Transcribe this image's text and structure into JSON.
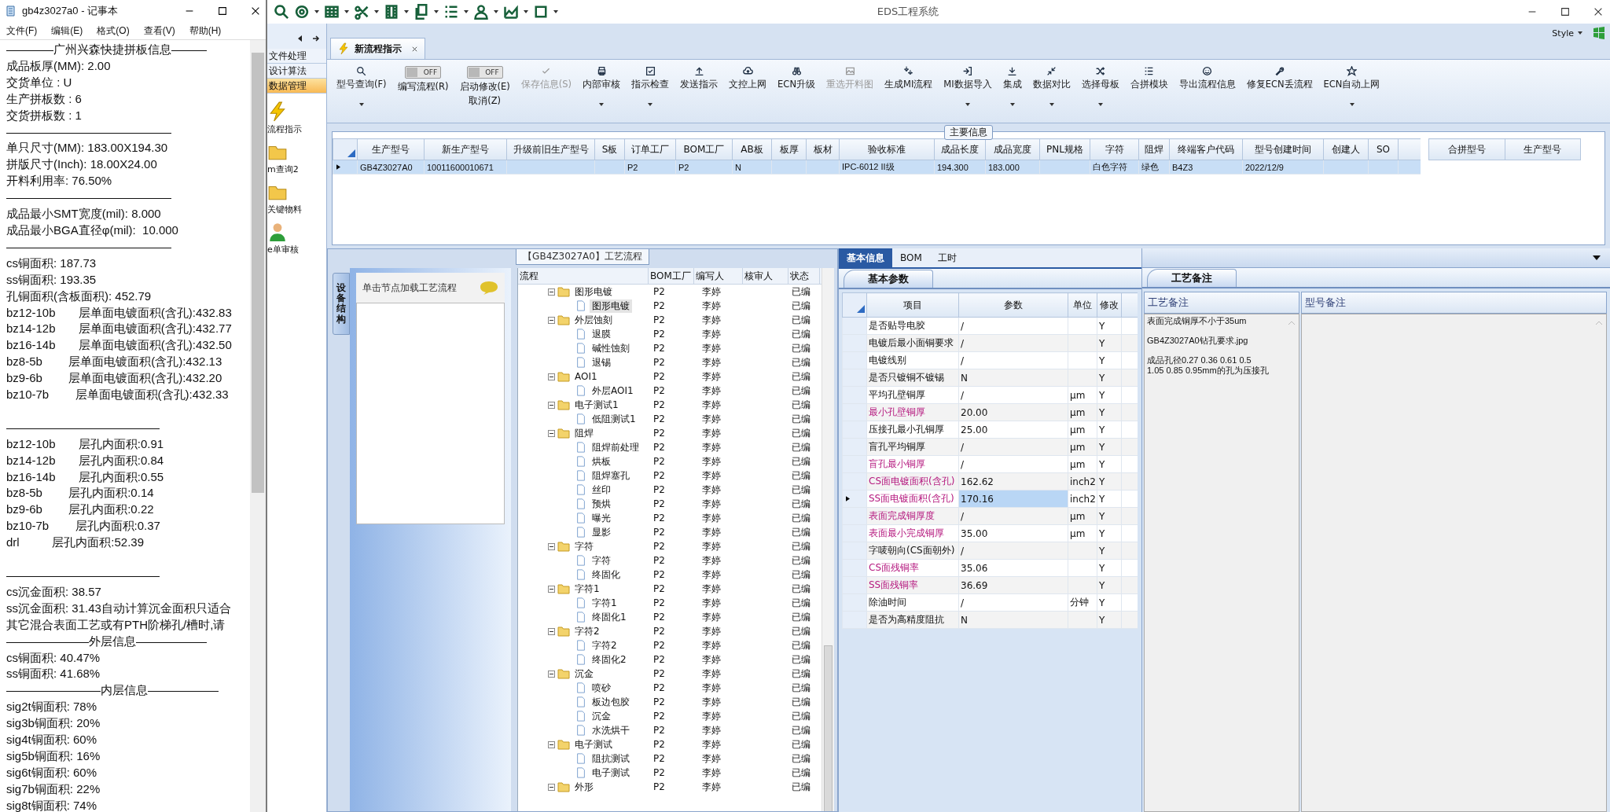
{
  "notepad": {
    "title": "gb4z3027a0 - 记事本",
    "menu": [
      "文件(F)",
      "编辑(E)",
      "格式(O)",
      "查看(V)",
      "帮助(H)"
    ],
    "lines": [
      {
        "text": "————广州兴森快捷拼板信息———",
        "space_before": false
      },
      {
        "text": "成品板厚(MM): 2.00",
        "space_before": false
      },
      {
        "text": "交货单位 : U",
        "space_before": false
      },
      {
        "text": "生产拼板数 : 6",
        "space_before": false
      },
      {
        "text": "交货拼板数 : 1",
        "space_before": false
      },
      {
        "text": "——————————————",
        "space_before": false
      },
      {
        "text": "单只尺寸(MM): 183.00X194.30",
        "space_before": false
      },
      {
        "text": "拼版尺寸(Inch): 18.00X24.00",
        "space_before": false
      },
      {
        "text": "开料利用率: 76.50%",
        "space_before": false
      },
      {
        "text": "——————————————",
        "space_before": false
      },
      {
        "text": "成品最小SMT宽度(mil): 8.000",
        "space_before": false
      },
      {
        "text": "成品最小BGA直径φ(mil):  10.000",
        "space_before": false
      },
      {
        "text": "——————————————",
        "space_before": false
      },
      {
        "text": "cs铜面积: 187.73",
        "space_before": false
      },
      {
        "text": "ss铜面积: 193.35",
        "space_before": false
      },
      {
        "text": "孔铜面积(含板面积): 452.79",
        "space_before": false
      },
      {
        "text": "bz12-10b       层单面电镀面积(含孔):432.83",
        "space_before": false
      },
      {
        "text": "bz14-12b       层单面电镀面积(含孔):432.77",
        "space_before": false
      },
      {
        "text": "bz16-14b       层单面电镀面积(含孔):432.50",
        "space_before": false
      },
      {
        "text": "bz8-5b        层单面电镀面积(含孔):432.13",
        "space_before": false
      },
      {
        "text": "bz9-6b        层单面电镀面积(含孔):432.20",
        "space_before": false
      },
      {
        "text": "bz10-7b        层单面电镀面积(含孔):432.33",
        "space_before": false
      },
      {
        "text": "—————————————",
        "space_before": true
      },
      {
        "text": "bz12-10b       层孔内面积:0.91",
        "space_before": false
      },
      {
        "text": "bz14-12b       层孔内面积:0.84",
        "space_before": false
      },
      {
        "text": "bz16-14b       层孔内面积:0.55",
        "space_before": false
      },
      {
        "text": "bz8-5b        层孔内面积:0.14",
        "space_before": false
      },
      {
        "text": "bz9-6b        层孔内面积:0.22",
        "space_before": false
      },
      {
        "text": "bz10-7b        层孔内面积:0.37",
        "space_before": false
      },
      {
        "text": "drl          层孔内面积:52.39",
        "space_before": false
      },
      {
        "text": "—————————————",
        "space_before": true
      },
      {
        "text": "cs沉金面积: 38.57",
        "space_before": false
      },
      {
        "text": "ss沉金面积: 31.43自动计算沉金面积只适合",
        "space_before": false
      },
      {
        "text": "其它混合表面工艺或有PTH阶梯孔/槽时,请",
        "space_before": false
      },
      {
        "text": "———————外层信息——————",
        "space_before": false
      },
      {
        "text": "cs铜面积: 40.47%",
        "space_before": false
      },
      {
        "text": "ss铜面积: 41.68%",
        "space_before": false
      },
      {
        "text": "————————内层信息——————",
        "space_before": false
      },
      {
        "text": "sig2t铜面积: 78%",
        "space_before": false
      },
      {
        "text": "sig3b铜面积: 20%",
        "space_before": false
      },
      {
        "text": "sig4t铜面积: 60%",
        "space_before": false
      },
      {
        "text": "sig5b铜面积: 16%",
        "space_before": false
      },
      {
        "text": "sig6t铜面积: 60%",
        "space_before": false
      },
      {
        "text": "sig7b铜面积: 22%",
        "space_before": false
      },
      {
        "text": "sig8t铜面积: 74%",
        "space_before": false
      }
    ]
  },
  "app": {
    "title": "EDS工程系统",
    "style_label": "Style"
  },
  "nav": {
    "menu": [
      {
        "label": "文件处理",
        "selected": false
      },
      {
        "label": "设计算法",
        "selected": false
      },
      {
        "label": "数据管理",
        "selected": true
      }
    ],
    "items": [
      {
        "label": "流程指示"
      },
      {
        "label": "m查询2"
      },
      {
        "label": "关键物料"
      },
      {
        "label": "e单审核"
      }
    ]
  },
  "tab": {
    "label": "新流程指示"
  },
  "ribbon": [
    {
      "kind": "button",
      "label": "型号查询(F)",
      "disabled": false,
      "dropdown": true
    },
    {
      "kind": "toggle",
      "label": "编写流程(R)",
      "on": false,
      "switch_text": "OFF"
    },
    {
      "kind": "toggle",
      "label": "启动修改(E)",
      "sublabel": "取消(Z)",
      "on": false,
      "switch_text": "OFF"
    },
    {
      "kind": "button",
      "label": "保存信息(S)",
      "disabled": true,
      "dropdown": false
    },
    {
      "kind": "button",
      "label": "内部审核",
      "disabled": false,
      "dropdown": true
    },
    {
      "kind": "button",
      "label": "指示检查",
      "disabled": false,
      "dropdown": true
    },
    {
      "kind": "button",
      "label": "发送指示",
      "disabled": false,
      "dropdown": false
    },
    {
      "kind": "button",
      "label": "文控上网",
      "disabled": false,
      "dropdown": false
    },
    {
      "kind": "button",
      "label": "ECN升级",
      "disabled": false,
      "dropdown": false
    },
    {
      "kind": "button",
      "label": "重选开料图",
      "disabled": true,
      "dropdown": false
    },
    {
      "kind": "button",
      "label": "生成MI流程",
      "disabled": false,
      "dropdown": false
    },
    {
      "kind": "button",
      "label": "MI数据导入",
      "disabled": false,
      "dropdown": true
    },
    {
      "kind": "button",
      "label": "集成",
      "disabled": false,
      "dropdown": true
    },
    {
      "kind": "button",
      "label": "数据对比",
      "disabled": false,
      "dropdown": true
    },
    {
      "kind": "button",
      "label": "选择母板",
      "disabled": false,
      "dropdown": true
    },
    {
      "kind": "button",
      "label": "合拼模块",
      "disabled": false,
      "dropdown": false
    },
    {
      "kind": "button",
      "label": "导出流程信息",
      "disabled": false,
      "dropdown": false
    },
    {
      "kind": "button",
      "label": "修复ECN丢流程",
      "disabled": false,
      "dropdown": false
    },
    {
      "kind": "button",
      "label": "ECN自动上网",
      "disabled": false,
      "dropdown": true
    }
  ],
  "main_info": {
    "title": "主要信息",
    "columns": [
      "生产型号",
      "新生产型号",
      "升级前旧生产型号",
      "S板",
      "订单工厂",
      "BOM工厂",
      "AB板",
      "板厚",
      "板材",
      "验收标准",
      "成品长度",
      "成品宽度",
      "PNL规格",
      "字符",
      "阻焊",
      "终端客户代码",
      "型号创建时间",
      "创建人",
      "SO"
    ],
    "rows": [
      {
        "selected": true,
        "cells": [
          "GB4Z3027A0",
          "10011600010671",
          null,
          null,
          "P2",
          "P2",
          "N",
          null,
          null,
          "IPC-6012 II级",
          "194.300",
          "183.000",
          null,
          "白色字符",
          "绿色",
          "B4Z3",
          "2022/12/9",
          null,
          null
        ]
      }
    ],
    "merge_columns": [
      "合拼型号",
      "生产型号"
    ]
  },
  "process": {
    "title": "【GB4Z3027A0】工艺流程",
    "side_tab": "设备结构",
    "hint": "单击节点加载工艺流程",
    "columns": [
      "流程",
      "BOM工厂",
      "编写人",
      "核审人",
      "状态"
    ],
    "tree": [
      {
        "label": "图形电镀",
        "bom": "P2",
        "writer": "李婷",
        "status": "已编",
        "expanded": true,
        "selected": false,
        "children": [
          {
            "label": "图形电镀",
            "bom": "P2",
            "writer": "李婷",
            "status": "已编",
            "selected": true
          }
        ]
      },
      {
        "label": "外层蚀刻",
        "bom": "P2",
        "writer": "李婷",
        "status": "已编",
        "expanded": true,
        "selected": false,
        "children": [
          {
            "label": "退膜",
            "bom": "P2",
            "writer": "李婷",
            "status": "已编",
            "selected": false
          },
          {
            "label": "碱性蚀刻",
            "bom": "P2",
            "writer": "李婷",
            "status": "已编",
            "selected": false
          },
          {
            "label": "退锡",
            "bom": "P2",
            "writer": "李婷",
            "status": "已编",
            "selected": false
          }
        ]
      },
      {
        "label": "AOI1",
        "bom": "P2",
        "writer": "李婷",
        "status": "已编",
        "expanded": true,
        "selected": false,
        "children": [
          {
            "label": "外层AOI1",
            "bom": "P2",
            "writer": "李婷",
            "status": "已编",
            "selected": false
          }
        ]
      },
      {
        "label": "电子测试1",
        "bom": "P2",
        "writer": "李婷",
        "status": "已编",
        "expanded": true,
        "selected": false,
        "children": [
          {
            "label": "低阻测试1",
            "bom": "P2",
            "writer": "李婷",
            "status": "已编",
            "selected": false
          }
        ]
      },
      {
        "label": "阻焊",
        "bom": "P2",
        "writer": "李婷",
        "status": "已编",
        "expanded": true,
        "selected": false,
        "children": [
          {
            "label": "阻焊前处理",
            "bom": "P2",
            "writer": "李婷",
            "status": "已编",
            "selected": false
          },
          {
            "label": "烘板",
            "bom": "P2",
            "writer": "李婷",
            "status": "已编",
            "selected": false
          },
          {
            "label": "阻焊塞孔",
            "bom": "P2",
            "writer": "李婷",
            "status": "已编",
            "selected": false
          },
          {
            "label": "丝印",
            "bom": "P2",
            "writer": "李婷",
            "status": "已编",
            "selected": false
          },
          {
            "label": "预烘",
            "bom": "P2",
            "writer": "李婷",
            "status": "已编",
            "selected": false
          },
          {
            "label": "曝光",
            "bom": "P2",
            "writer": "李婷",
            "status": "已编",
            "selected": false
          },
          {
            "label": "显影",
            "bom": "P2",
            "writer": "李婷",
            "status": "已编",
            "selected": false
          }
        ]
      },
      {
        "label": "字符",
        "bom": "P2",
        "writer": "李婷",
        "status": "已编",
        "expanded": true,
        "selected": false,
        "children": [
          {
            "label": "字符",
            "bom": "P2",
            "writer": "李婷",
            "status": "已编",
            "selected": false
          },
          {
            "label": "终固化",
            "bom": "P2",
            "writer": "李婷",
            "status": "已编",
            "selected": false
          }
        ]
      },
      {
        "label": "字符1",
        "bom": "P2",
        "writer": "李婷",
        "status": "已编",
        "expanded": true,
        "selected": false,
        "children": [
          {
            "label": "字符1",
            "bom": "P2",
            "writer": "李婷",
            "status": "已编",
            "selected": false
          },
          {
            "label": "终固化1",
            "bom": "P2",
            "writer": "李婷",
            "status": "已编",
            "selected": false
          }
        ]
      },
      {
        "label": "字符2",
        "bom": "P2",
        "writer": "李婷",
        "status": "已编",
        "expanded": true,
        "selected": false,
        "children": [
          {
            "label": "字符2",
            "bom": "P2",
            "writer": "李婷",
            "status": "已编",
            "selected": false
          },
          {
            "label": "终固化2",
            "bom": "P2",
            "writer": "李婷",
            "status": "已编",
            "selected": false
          }
        ]
      },
      {
        "label": "沉金",
        "bom": "P2",
        "writer": "李婷",
        "status": "已编",
        "expanded": true,
        "selected": false,
        "children": [
          {
            "label": "喷砂",
            "bom": "P2",
            "writer": "李婷",
            "status": "已编",
            "selected": false
          },
          {
            "label": "板边包胶",
            "bom": "P2",
            "writer": "李婷",
            "status": "已编",
            "selected": false
          },
          {
            "label": "沉金",
            "bom": "P2",
            "writer": "李婷",
            "status": "已编",
            "selected": false
          },
          {
            "label": "水洗烘干",
            "bom": "P2",
            "writer": "李婷",
            "status": "已编",
            "selected": false
          }
        ]
      },
      {
        "label": "电子测试",
        "bom": "P2",
        "writer": "李婷",
        "status": "已编",
        "expanded": true,
        "selected": false,
        "children": [
          {
            "label": "阻抗测试",
            "bom": "P2",
            "writer": "李婷",
            "status": "已编",
            "selected": false
          },
          {
            "label": "电子测试",
            "bom": "P2",
            "writer": "李婷",
            "status": "已编",
            "selected": false
          }
        ]
      },
      {
        "label": "外形",
        "bom": "P2",
        "writer": "李婷",
        "status": "已编",
        "expanded": true,
        "selected": false
      }
    ]
  },
  "basic": {
    "tabs": [
      {
        "label": "基本信息",
        "selected": true
      },
      {
        "label": "BOM",
        "selected": false
      },
      {
        "label": "工时",
        "selected": false
      }
    ],
    "subtab": {
      "label": "基本参数",
      "selected": true
    },
    "columns": [
      "项目",
      "参数",
      "单位",
      "修改"
    ],
    "rows": [
      {
        "item": "是否贴导电胶",
        "value": "/",
        "modified": "Y",
        "flagged": false,
        "selected": false
      },
      {
        "item": "电镀后最小面铜要求",
        "value": "/",
        "modified": "Y",
        "flagged": false,
        "selected": false
      },
      {
        "item": "电镀线别",
        "value": "/",
        "modified": "Y",
        "flagged": false,
        "selected": false
      },
      {
        "item": "是否只镀铜不镀锡",
        "value": "N",
        "modified": "Y",
        "flagged": false,
        "selected": false
      },
      {
        "item": "平均孔壁铜厚",
        "value": "/",
        "unit": "μm",
        "modified": "Y",
        "flagged": false,
        "selected": false
      },
      {
        "item": "最小孔壁铜厚",
        "value": "20.00",
        "unit": "μm",
        "modified": "Y",
        "flagged": true,
        "selected": false
      },
      {
        "item": "压接孔最小孔铜厚",
        "value": "25.00",
        "unit": "μm",
        "modified": "Y",
        "flagged": false,
        "selected": false
      },
      {
        "item": "盲孔平均铜厚",
        "value": "/",
        "unit": "μm",
        "modified": "Y",
        "flagged": false,
        "selected": false
      },
      {
        "item": "盲孔最小铜厚",
        "value": "/",
        "unit": "μm",
        "modified": "Y",
        "flagged": true,
        "selected": false
      },
      {
        "item": "CS面电镀面积(含孔)",
        "value": "162.62",
        "unit": "inch2",
        "modified": "Y",
        "flagged": true,
        "selected": false
      },
      {
        "item": "SS面电镀面积(含孔)",
        "value": "170.16",
        "unit": "inch2",
        "modified": "Y",
        "flagged": true,
        "selected": true
      },
      {
        "item": "表面完成铜厚度",
        "value": "/",
        "unit": "μm",
        "modified": "Y",
        "flagged": true,
        "selected": false
      },
      {
        "item": "表面最小完成铜厚",
        "value": "35.00",
        "unit": "μm",
        "modified": "Y",
        "flagged": true,
        "selected": false
      },
      {
        "item": "字唛朝向(CS面朝外)",
        "value": "/",
        "modified": "Y",
        "flagged": false,
        "selected": false
      },
      {
        "item": "CS面残铜率",
        "value": "35.06",
        "modified": "Y",
        "flagged": true,
        "selected": false
      },
      {
        "item": "SS面残铜率",
        "value": "36.69",
        "modified": "Y",
        "flagged": true,
        "selected": false
      },
      {
        "item": "除油时间",
        "value": "/",
        "unit": "分钟",
        "modified": "Y",
        "flagged": false,
        "selected": false
      },
      {
        "item": "是否为高精度阻抗",
        "value": "N",
        "modified": "Y",
        "flagged": false,
        "selected": false
      }
    ]
  },
  "notes": {
    "tab": {
      "label": "工艺备注",
      "selected": true
    },
    "columns": [
      "工艺备注",
      "型号备注"
    ],
    "process_notes": [
      {
        "text": "表面完成铜厚不小于35um",
        "space_before": false
      },
      {
        "text": "GB4Z3027A0钻孔要求.jpg",
        "space_before": true
      },
      {
        "text": "成品孔径0.27 0.36 0.61 0.5",
        "space_before": true
      },
      {
        "text": "1.05 0.85 0.95mm的孔为压接孔",
        "space_before": false
      }
    ]
  }
}
